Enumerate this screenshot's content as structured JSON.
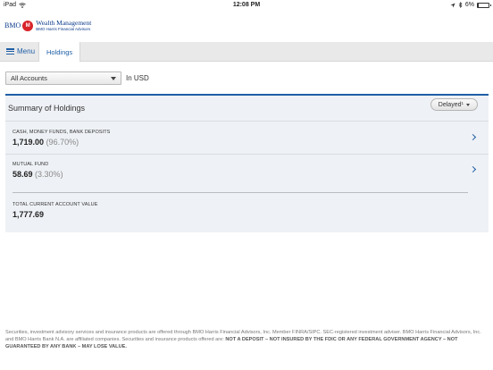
{
  "status_bar": {
    "device": "iPad",
    "time": "12:08 PM",
    "battery": "6%",
    "battery_level": 0.06,
    "icons": [
      "wifi-icon",
      "location-icon",
      "bluetooth-icon",
      "battery-icon"
    ]
  },
  "brand": {
    "bmo": "BMO",
    "roundel": "M",
    "name": "Wealth Management",
    "subname": "BMO Harris Financial Advisors"
  },
  "nav": {
    "menu_label": "Menu",
    "tab_label": "Holdings"
  },
  "account_select": {
    "selected": "All Accounts"
  },
  "currency_label": "In USD",
  "summary": {
    "title": "Summary of Holdings",
    "delayed_label": "Delayed",
    "delayed_mark": "1",
    "rows": [
      {
        "label": "CASH, MONEY FUNDS, BANK DEPOSITS",
        "value": "1,719.00",
        "percent": "(96.70%)"
      },
      {
        "label": "MUTUAL FUND",
        "value": "58.69",
        "percent": "(3.30%)"
      }
    ],
    "total_label": "TOTAL CURRENT ACCOUNT VALUE",
    "total_value": "1,777.69"
  },
  "footer": {
    "text": "Securities, investment advisory services and insurance products are offered through BMO Harris Financial Advisors, Inc. Member FINRA/SIPC. SEC-registered investment adviser. BMO Harris Financial Advisors, Inc. and BMO Harris Bank N.A. are affiliated companies. Securities and insurance products offered are: ",
    "bold": "NOT A DEPOSIT – NOT INSURED BY THE FDIC OR ANY FEDERAL GOVERNMENT AGENCY – NOT GUARANTEED BY ANY BANK – MAY LOSE VALUE."
  },
  "colors": {
    "accent": "#1f5fa6",
    "brand_red": "#d8232a",
    "panel_bg": "#eef1f5"
  }
}
